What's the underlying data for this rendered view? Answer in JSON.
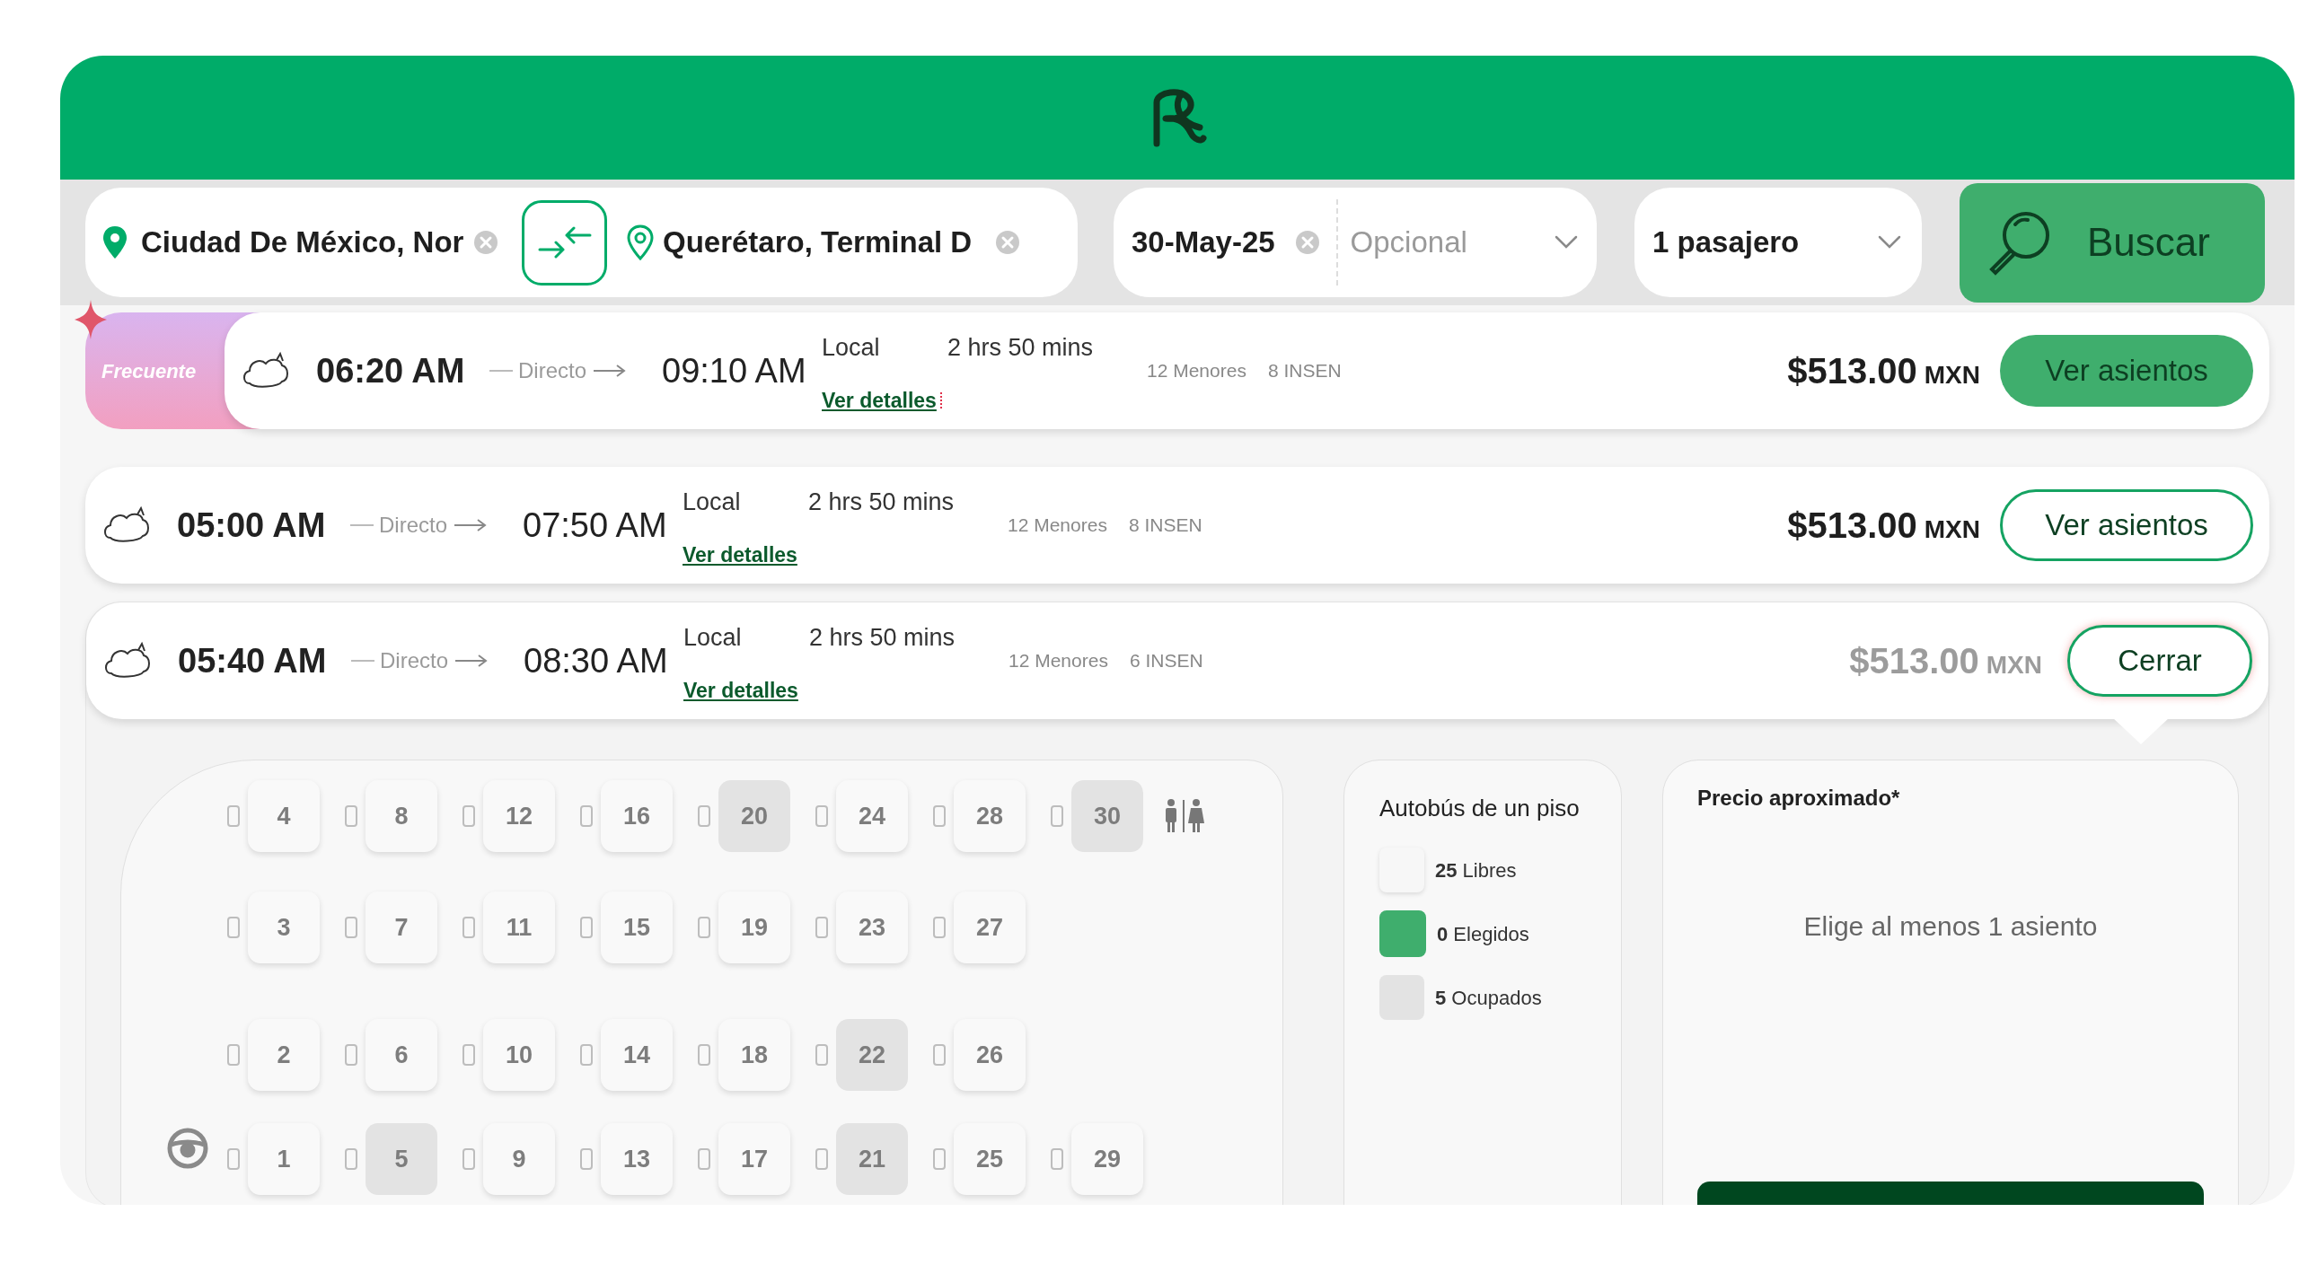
{
  "search": {
    "origin": "Ciudad De México, Nor",
    "destination": "Querétaro, Terminal D",
    "date": "30-May-25",
    "return_placeholder": "Opcional",
    "passengers": "1 pasajero",
    "button": "Buscar"
  },
  "trips": [
    {
      "badge": "Frecuente",
      "departure": "06:20 AM",
      "route": "Directo",
      "arrival": "09:10 AM",
      "service": "Local",
      "duration": "2 hrs 50 mins",
      "details_link": "Ver detalles",
      "details_alert": true,
      "minors": "12 Menores",
      "insen": "8 INSEN",
      "price": "$513.00",
      "currency": "MXN",
      "action": "Ver asientos",
      "highlighted": true,
      "expanded": false
    },
    {
      "departure": "05:00 AM",
      "route": "Directo",
      "arrival": "07:50 AM",
      "service": "Local",
      "duration": "2 hrs 50 mins",
      "details_link": "Ver detalles",
      "details_alert": false,
      "minors": "12 Menores",
      "insen": "8 INSEN",
      "price": "$513.00",
      "currency": "MXN",
      "action": "Ver asientos",
      "highlighted": false,
      "expanded": false
    },
    {
      "departure": "05:40 AM",
      "route": "Directo",
      "arrival": "08:30 AM",
      "service": "Local",
      "duration": "2 hrs 50 mins",
      "details_link": "Ver detalles",
      "details_alert": false,
      "minors": "12 Menores",
      "insen": "6 INSEN",
      "price": "$513.00",
      "currency": "MXN",
      "action": "Cerrar",
      "highlighted": false,
      "expanded": true
    }
  ],
  "seat_map": {
    "rows": [
      [
        {
          "number": "4",
          "occupied": false
        },
        {
          "number": "8",
          "occupied": false
        },
        {
          "number": "12",
          "occupied": false
        },
        {
          "number": "16",
          "occupied": false
        },
        {
          "number": "20",
          "occupied": true
        },
        {
          "number": "24",
          "occupied": false
        },
        {
          "number": "28",
          "occupied": false
        },
        {
          "number": "30",
          "occupied": true
        }
      ],
      [
        {
          "number": "3",
          "occupied": false
        },
        {
          "number": "7",
          "occupied": false
        },
        {
          "number": "11",
          "occupied": false
        },
        {
          "number": "15",
          "occupied": false
        },
        {
          "number": "19",
          "occupied": false
        },
        {
          "number": "23",
          "occupied": false
        },
        {
          "number": "27",
          "occupied": false
        }
      ],
      [
        {
          "number": "2",
          "occupied": false
        },
        {
          "number": "6",
          "occupied": false
        },
        {
          "number": "10",
          "occupied": false
        },
        {
          "number": "14",
          "occupied": false
        },
        {
          "number": "18",
          "occupied": false
        },
        {
          "number": "22",
          "occupied": true
        },
        {
          "number": "26",
          "occupied": false
        }
      ],
      [
        {
          "number": "1",
          "occupied": false
        },
        {
          "number": "5",
          "occupied": true
        },
        {
          "number": "9",
          "occupied": false
        },
        {
          "number": "13",
          "occupied": false
        },
        {
          "number": "17",
          "occupied": false
        },
        {
          "number": "21",
          "occupied": true
        },
        {
          "number": "25",
          "occupied": false
        },
        {
          "number": "29",
          "occupied": false
        }
      ]
    ]
  },
  "legend": {
    "title": "Autobús de un piso",
    "items": [
      {
        "kind": "free",
        "text": "**25** Libres"
      },
      {
        "kind": "chosen",
        "text": "**0** Elegidos"
      },
      {
        "kind": "occupied",
        "text": "**5** Ocupados"
      }
    ]
  },
  "price_panel": {
    "title": "Precio aproximado*",
    "message": "Elige al menos 1 asiento"
  }
}
